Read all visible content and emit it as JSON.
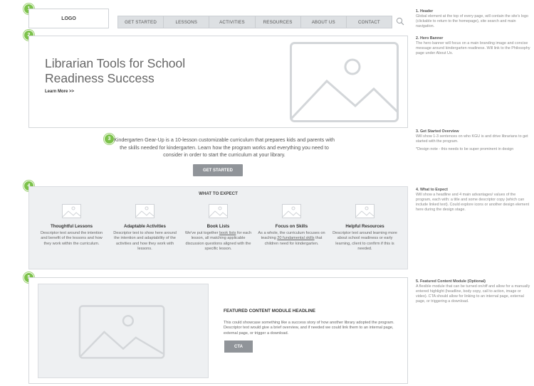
{
  "header": {
    "logo": "LOGO",
    "nav": [
      "GET STARTED",
      "LESSONS",
      "ACTIVITIES",
      "RESOURCES",
      "ABOUT US",
      "CONTACT"
    ]
  },
  "badges": [
    "1",
    "2",
    "3",
    "4",
    "5"
  ],
  "hero": {
    "title": "Librarian Tools for School Readiness Success",
    "link": "Learn More >>"
  },
  "get_started": {
    "text": "Kindergarten Gear-Up is a 10-lesson customizable curriculum that prepares kids and parents with the skills needed for kindergarten. Learn how the program works and everything you need to consider in order to start the curriculum at your library.",
    "button": "GET STARTED"
  },
  "expect": {
    "title": "WHAT TO EXPECT",
    "items": [
      {
        "title": "Thoughtful Lessons",
        "desc": "Descriptor text around the intention and benefit of the lessons  and how they work within  the curriculum."
      },
      {
        "title": "Adaptable Activities",
        "desc": "Descriptor text to show here around the intention and adaptability of the activities and how they work with lessons."
      },
      {
        "title": "Book Lists",
        "desc_pre": "We've put together ",
        "desc_link": "book lists",
        "desc_post": " for each lesson, all matching applicable discussion questions aligned with the specific lesson."
      },
      {
        "title": "Focus on Skills",
        "desc_pre": "As a whole, the curriculum focuses on teaching ",
        "desc_link": "20 fundamental skills",
        "desc_post": " that children need for kindergarten."
      },
      {
        "title": "Helpful Resources",
        "desc": "Descriptor text around learning more about school readiness or early learning, client to confirm if this is needed."
      }
    ]
  },
  "featured": {
    "headline": "FEATURED CONTENT MODULE HEADLINE",
    "desc": "This could showcase something like a success story of how another library adopted the program. Descriptor text would give a brief overview, and if needed we could link them to an internal page, external page, or trigger a download.",
    "cta": "CTA"
  },
  "notes": [
    {
      "title": "1. Header",
      "body": "Global element at the top of every page, will contain the site's logo (clickable to return to the homepage), site search and main navigation."
    },
    {
      "title": "2. Hero Banner",
      "body": "The hero banner will focus on a main branding image and concise message around kindergarten readiness. Will link to the Philosophy page under About Us."
    },
    {
      "title": "3. Get Started Overview",
      "body": "Will show 1-3 sentences on who KGU is and drive librarians to get started with the program.",
      "extra": "*Design note - this needs to be super prominent in design"
    },
    {
      "title": "4. What to Expect",
      "body": "Will show a headline and 4 main advantages/ values of the program, each with: a title and some descriptor copy (which can include linked text). Could explore icons or another design element here during the design stage."
    },
    {
      "title": "5. Featured Content Module (Optional)",
      "body": "A flexible module that can be turned on/off and allow for a manually entered highlight (headline, body copy, call to action, image or video). CTA should allow for linking to an internal page, external page, or triggering a download."
    }
  ]
}
